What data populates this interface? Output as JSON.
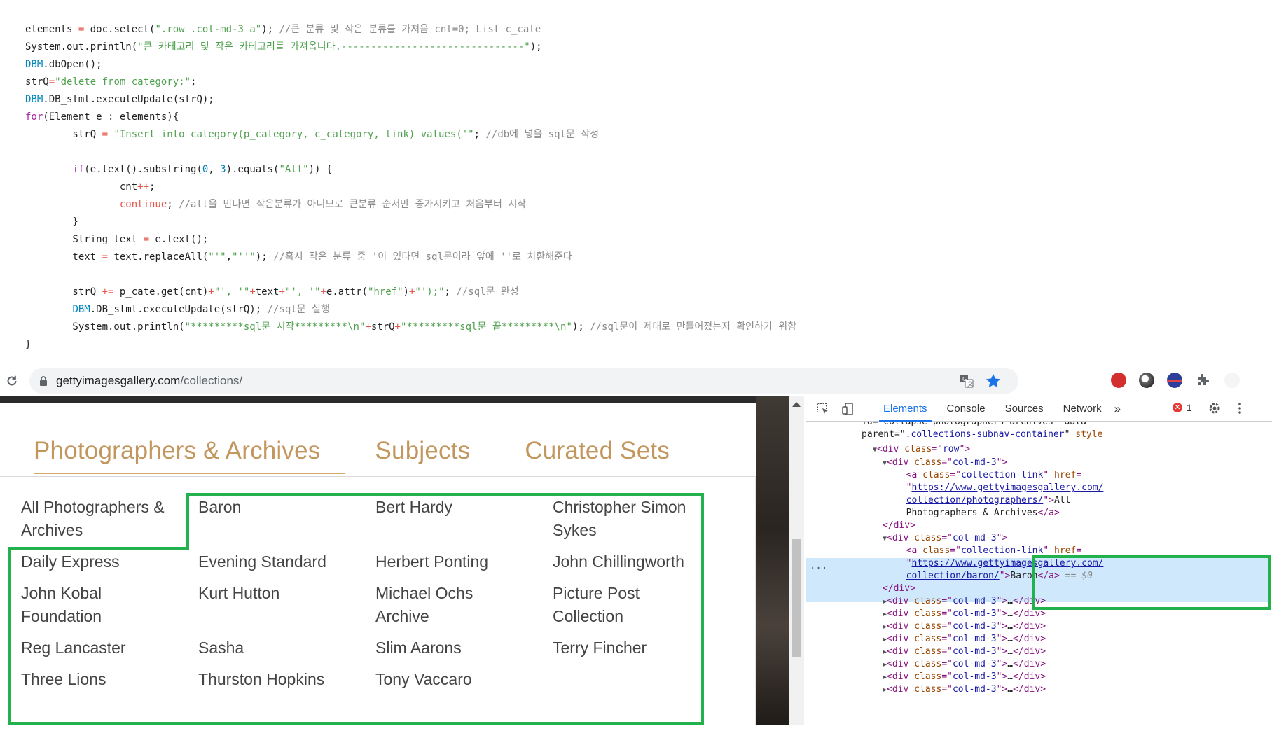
{
  "code": {
    "lines": [
      [
        [
          "pl",
          "elements "
        ],
        [
          "op",
          "="
        ],
        [
          "pl",
          " doc.select("
        ],
        [
          "str",
          "\".row .col-md-3 a\""
        ],
        [
          "pl",
          "); "
        ],
        [
          "cm",
          "//큰 분류 및 작은 분류를 가져옴 cnt=0; List c_cate"
        ]
      ],
      [
        [
          "pl",
          "System.out.println("
        ],
        [
          "str",
          "\"큰 카테고리 및 작은 카테고리를 가져옵니다.-------------------------------\""
        ],
        [
          "pl",
          ");"
        ]
      ],
      [
        [
          "ty",
          "DBM"
        ],
        [
          "pl",
          ".dbOpen();"
        ]
      ],
      [
        [
          "pl",
          "strQ"
        ],
        [
          "op",
          "="
        ],
        [
          "str",
          "\"delete from category;\""
        ],
        [
          "pl",
          ";"
        ]
      ],
      [
        [
          "ty",
          "DBM"
        ],
        [
          "pl",
          ".DB_stmt.executeUpdate(strQ);"
        ]
      ],
      [
        [
          "kw",
          "for"
        ],
        [
          "pl",
          "(Element e : elements){"
        ]
      ],
      [
        [
          "pl",
          "        strQ "
        ],
        [
          "op",
          "="
        ],
        [
          "pl",
          " "
        ],
        [
          "str",
          "\"Insert into category(p_category, c_category, link) values('\""
        ],
        [
          "pl",
          "; "
        ],
        [
          "cm",
          "//db에 넣을 sql문 작성"
        ]
      ],
      [
        [
          "pl",
          ""
        ]
      ],
      [
        [
          "pl",
          "        "
        ],
        [
          "kw",
          "if"
        ],
        [
          "pl",
          "(e.text().substring("
        ],
        [
          "ty",
          "0"
        ],
        [
          "pl",
          ", "
        ],
        [
          "ty",
          "3"
        ],
        [
          "pl",
          ").equals("
        ],
        [
          "str",
          "\"All\""
        ],
        [
          "pl",
          ")) {"
        ]
      ],
      [
        [
          "pl",
          "                cnt"
        ],
        [
          "op",
          "++"
        ],
        [
          "pl",
          ";"
        ]
      ],
      [
        [
          "pl",
          "                "
        ],
        [
          "op",
          "continue"
        ],
        [
          "pl",
          "; "
        ],
        [
          "cm",
          "//all을 만나면 작은분류가 아니므로 큰분류 순서만 증가시키고 처음부터 시작"
        ]
      ],
      [
        [
          "pl",
          "        }"
        ]
      ],
      [
        [
          "pl",
          "        String text "
        ],
        [
          "op",
          "="
        ],
        [
          "pl",
          " e.text();"
        ]
      ],
      [
        [
          "pl",
          "        text "
        ],
        [
          "op",
          "="
        ],
        [
          "pl",
          " text.replaceAll("
        ],
        [
          "str",
          "\"'\""
        ],
        [
          "pl",
          ","
        ],
        [
          "str",
          "\"''\""
        ],
        [
          "pl",
          "); "
        ],
        [
          "cm",
          "//혹시 작은 분류 중 '이 있다면 sql문이라 앞에 ''로 치환해준다"
        ]
      ],
      [
        [
          "pl",
          ""
        ]
      ],
      [
        [
          "pl",
          "        strQ "
        ],
        [
          "op",
          "+="
        ],
        [
          "pl",
          " p_cate.get(cnt)"
        ],
        [
          "op",
          "+"
        ],
        [
          "str",
          "\"', '\""
        ],
        [
          "op",
          "+"
        ],
        [
          "pl",
          "text"
        ],
        [
          "op",
          "+"
        ],
        [
          "str",
          "\"', '\""
        ],
        [
          "op",
          "+"
        ],
        [
          "pl",
          "e.attr("
        ],
        [
          "str",
          "\"href\""
        ],
        [
          "pl",
          ")"
        ],
        [
          "op",
          "+"
        ],
        [
          "str",
          "\"');\""
        ],
        [
          "pl",
          "; "
        ],
        [
          "cm",
          "//sql문 완성"
        ]
      ],
      [
        [
          "pl",
          "        "
        ],
        [
          "ty",
          "DBM"
        ],
        [
          "pl",
          ".DB_stmt.executeUpdate(strQ); "
        ],
        [
          "cm",
          "//sql문 실행"
        ]
      ],
      [
        [
          "pl",
          "        System.out.println("
        ],
        [
          "str",
          "\"*********sql문 시작*********\\n\""
        ],
        [
          "op",
          "+"
        ],
        [
          "pl",
          "strQ"
        ],
        [
          "op",
          "+"
        ],
        [
          "str",
          "\"*********sql문 끝*********\\n\""
        ],
        [
          "pl",
          "); "
        ],
        [
          "cm",
          "//sql문이 제대로 만들어졌는지 확인하기 위함"
        ]
      ],
      [
        [
          "pl",
          "}"
        ]
      ]
    ]
  },
  "browser": {
    "url_domain": "gettyimagesgallery.com",
    "url_path": "/collections/"
  },
  "site": {
    "tabs": [
      "Photographers & Archives",
      "Subjects",
      "Curated Sets"
    ],
    "links": [
      [
        "All Photographers &",
        "Archives"
      ],
      [
        "Baron"
      ],
      [
        "Bert Hardy"
      ],
      [
        "Christopher Simon",
        "Sykes"
      ],
      [
        "Daily Express"
      ],
      [
        "Evening Standard"
      ],
      [
        "Herbert Ponting"
      ],
      [
        "John Chillingworth"
      ],
      [
        "John Kobal",
        "Foundation"
      ],
      [
        "Kurt Hutton"
      ],
      [
        "Michael Ochs",
        "Archive"
      ],
      [
        "Picture Post",
        "Collection"
      ],
      [
        "Reg Lancaster"
      ],
      [
        "Sasha"
      ],
      [
        "Slim Aarons"
      ],
      [
        "Terry Fincher"
      ],
      [
        "Three Lions"
      ],
      [
        "Thurston Hopkins"
      ],
      [
        "Tony Vaccaro"
      ]
    ]
  },
  "devtools": {
    "tabs": [
      "Elements",
      "Console",
      "Sources",
      "Network"
    ],
    "more": "»",
    "error_count": "1",
    "error_glyph": "✕",
    "ellipsis": "...",
    "dom": [
      {
        "indent": 0,
        "parts": [
          [
            "pl",
            "id=\"collapse-photographers-archives\" data-"
          ]
        ]
      },
      {
        "indent": 0,
        "parts": [
          [
            "pl",
            "parent=\""
          ],
          [
            "val",
            ".collections-subnav-container"
          ],
          [
            "pl",
            "\" "
          ],
          [
            "attr",
            "style"
          ]
        ]
      },
      {
        "indent": 1,
        "tri": "▼",
        "parts": [
          [
            "tag",
            "<div "
          ],
          [
            "attr",
            "class"
          ],
          [
            "tag",
            "=\""
          ],
          [
            "val",
            "row"
          ],
          [
            "tag",
            "\">"
          ]
        ]
      },
      {
        "indent": 2,
        "tri": "▼",
        "parts": [
          [
            "tag",
            "<div "
          ],
          [
            "attr",
            "class"
          ],
          [
            "tag",
            "=\""
          ],
          [
            "val",
            "col-md-3"
          ],
          [
            "tag",
            "\">"
          ]
        ]
      },
      {
        "indent": 3,
        "parts": [
          [
            "tag",
            "<a "
          ],
          [
            "attr",
            "class"
          ],
          [
            "tag",
            "=\""
          ],
          [
            "val",
            "collection-link"
          ],
          [
            "tag",
            "\" "
          ],
          [
            "attr",
            "href"
          ],
          [
            "tag",
            "="
          ]
        ]
      },
      {
        "indent": 3,
        "parts": [
          [
            "tag",
            "\""
          ],
          [
            "link",
            "https://www.gettyimagesgallery.com/"
          ]
        ]
      },
      {
        "indent": 3,
        "parts": [
          [
            "link",
            "collection/photographers/"
          ],
          [
            "tag",
            "\">"
          ],
          [
            "pl",
            "All"
          ]
        ]
      },
      {
        "indent": 3,
        "parts": [
          [
            "pl",
            "Photographers & Archives"
          ],
          [
            "tag",
            "</a>"
          ]
        ]
      },
      {
        "indent": 2,
        "parts": [
          [
            "tag",
            "</div>"
          ]
        ]
      },
      {
        "indent": 2,
        "tri": "▼",
        "parts": [
          [
            "tag",
            "<div "
          ],
          [
            "attr",
            "class"
          ],
          [
            "tag",
            "=\""
          ],
          [
            "val",
            "col-md-3"
          ],
          [
            "tag",
            "\">"
          ]
        ]
      },
      {
        "indent": 3,
        "parts": [
          [
            "tag",
            "<a "
          ],
          [
            "attr",
            "class"
          ],
          [
            "tag",
            "=\""
          ],
          [
            "val",
            "collection-link"
          ],
          [
            "tag",
            "\" "
          ],
          [
            "attr",
            "href"
          ],
          [
            "tag",
            "="
          ]
        ]
      },
      {
        "indent": 3,
        "parts": [
          [
            "tag",
            "\""
          ],
          [
            "link",
            "https://www.gettyimagesgallery.com/"
          ]
        ]
      },
      {
        "indent": 3,
        "parts": [
          [
            "link",
            "collection/baron/"
          ],
          [
            "tag",
            "\">"
          ],
          [
            "pl",
            "Baron"
          ],
          [
            "tag",
            "</a>"
          ],
          [
            "eq",
            " == $0"
          ]
        ]
      },
      {
        "indent": 2,
        "parts": [
          [
            "tag",
            "</div>"
          ]
        ]
      },
      {
        "indent": 2,
        "tri": "▶",
        "parts": [
          [
            "tag",
            "<div "
          ],
          [
            "attr",
            "class"
          ],
          [
            "tag",
            "=\""
          ],
          [
            "val",
            "col-md-3"
          ],
          [
            "tag",
            "\">"
          ],
          [
            "pl",
            "…"
          ],
          [
            "tag",
            "</div>"
          ]
        ]
      },
      {
        "indent": 2,
        "tri": "▶",
        "parts": [
          [
            "tag",
            "<div "
          ],
          [
            "attr",
            "class"
          ],
          [
            "tag",
            "=\""
          ],
          [
            "val",
            "col-md-3"
          ],
          [
            "tag",
            "\">"
          ],
          [
            "pl",
            "…"
          ],
          [
            "tag",
            "</div>"
          ]
        ]
      },
      {
        "indent": 2,
        "tri": "▶",
        "parts": [
          [
            "tag",
            "<div "
          ],
          [
            "attr",
            "class"
          ],
          [
            "tag",
            "=\""
          ],
          [
            "val",
            "col-md-3"
          ],
          [
            "tag",
            "\">"
          ],
          [
            "pl",
            "…"
          ],
          [
            "tag",
            "</div>"
          ]
        ]
      },
      {
        "indent": 2,
        "tri": "▶",
        "parts": [
          [
            "tag",
            "<div "
          ],
          [
            "attr",
            "class"
          ],
          [
            "tag",
            "=\""
          ],
          [
            "val",
            "col-md-3"
          ],
          [
            "tag",
            "\">"
          ],
          [
            "pl",
            "…"
          ],
          [
            "tag",
            "</div>"
          ]
        ]
      },
      {
        "indent": 2,
        "tri": "▶",
        "parts": [
          [
            "tag",
            "<div "
          ],
          [
            "attr",
            "class"
          ],
          [
            "tag",
            "=\""
          ],
          [
            "val",
            "col-md-3"
          ],
          [
            "tag",
            "\">"
          ],
          [
            "pl",
            "…"
          ],
          [
            "tag",
            "</div>"
          ]
        ]
      },
      {
        "indent": 2,
        "tri": "▶",
        "parts": [
          [
            "tag",
            "<div "
          ],
          [
            "attr",
            "class"
          ],
          [
            "tag",
            "=\""
          ],
          [
            "val",
            "col-md-3"
          ],
          [
            "tag",
            "\">"
          ],
          [
            "pl",
            "…"
          ],
          [
            "tag",
            "</div>"
          ]
        ]
      },
      {
        "indent": 2,
        "tri": "▶",
        "parts": [
          [
            "tag",
            "<div "
          ],
          [
            "attr",
            "class"
          ],
          [
            "tag",
            "=\""
          ],
          [
            "val",
            "col-md-3"
          ],
          [
            "tag",
            "\">"
          ],
          [
            "pl",
            "…"
          ],
          [
            "tag",
            "</div>"
          ]
        ]
      },
      {
        "indent": 2,
        "tri": "▶",
        "parts": [
          [
            "tag",
            "<div "
          ],
          [
            "attr",
            "class"
          ],
          [
            "tag",
            "=\""
          ],
          [
            "val",
            "col-md-3"
          ],
          [
            "tag",
            "\">"
          ],
          [
            "pl",
            "…"
          ],
          [
            "tag",
            "</div>"
          ]
        ]
      }
    ]
  },
  "colors": {
    "accent_tab": "#c2965d",
    "annotation_green": "#22b14c",
    "devtools_selected": "#cfe8fc"
  },
  "icons": [
    "reload-icon",
    "lock-icon",
    "translate-icon",
    "star-icon",
    "inspect-icon",
    "device-toolbar-icon",
    "gear-icon",
    "kebab-menu-icon"
  ]
}
